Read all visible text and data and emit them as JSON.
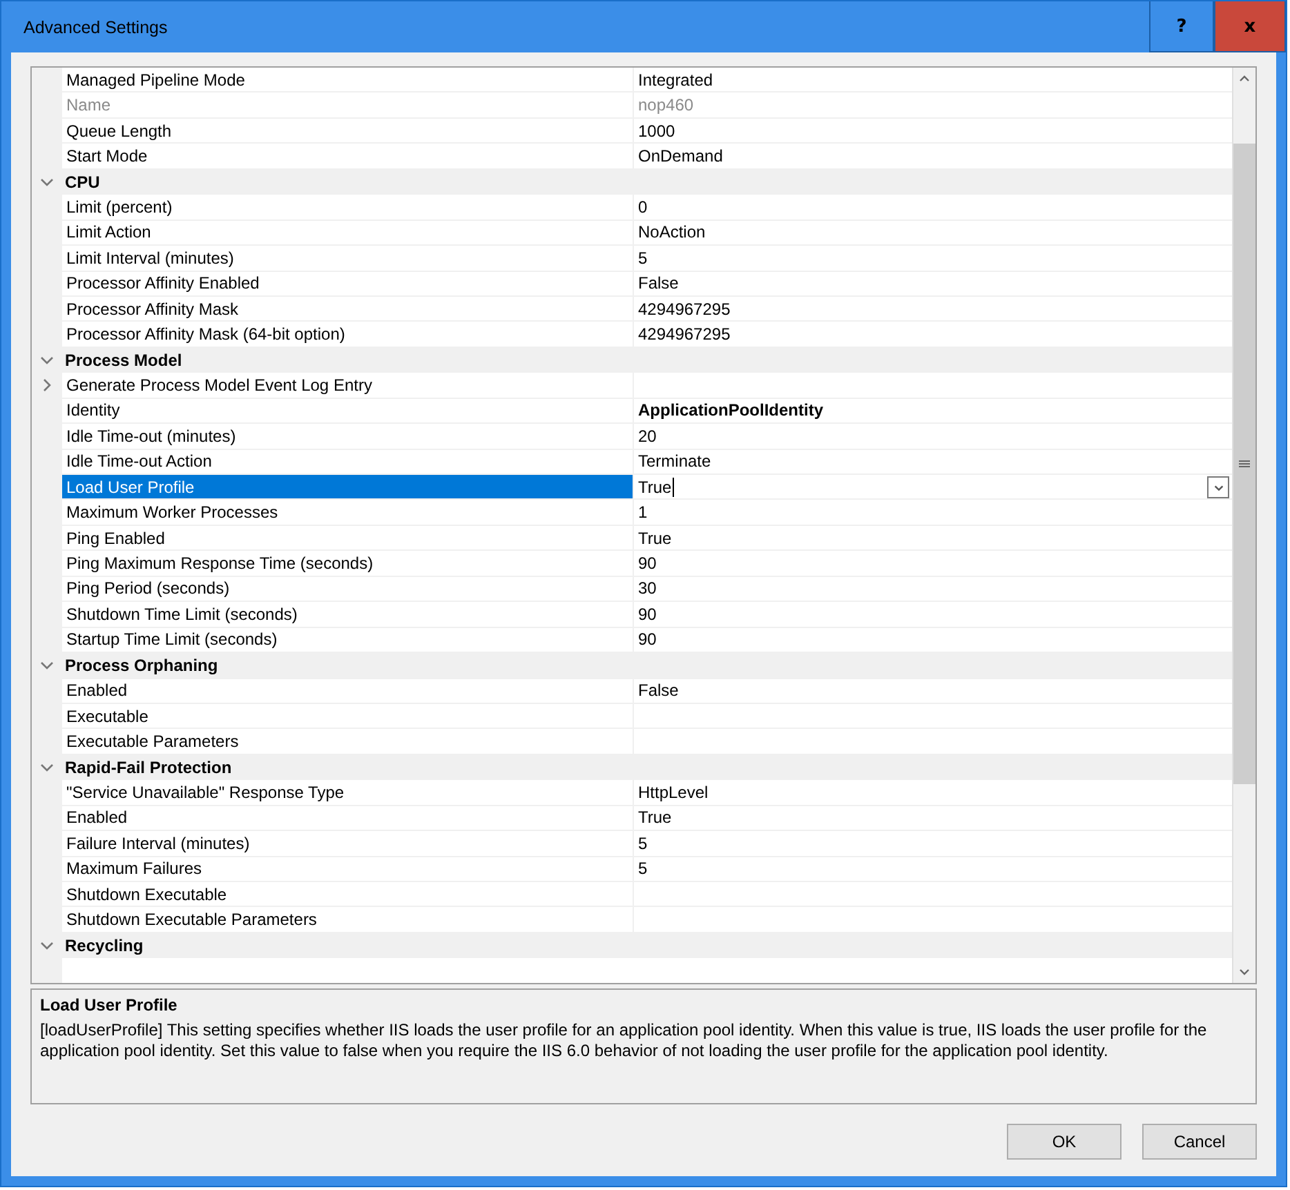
{
  "window": {
    "title": "Advanced Settings",
    "help_button": "?",
    "close_button": "x"
  },
  "grid": {
    "rows": [
      {
        "kind": "property",
        "name": "Managed Pipeline Mode",
        "value": "Integrated",
        "disabled": false,
        "modified": false,
        "selected": false
      },
      {
        "kind": "property",
        "name": "Name",
        "value": "nop460",
        "disabled": true,
        "modified": false,
        "selected": false
      },
      {
        "kind": "property",
        "name": "Queue Length",
        "value": "1000",
        "disabled": false,
        "modified": false,
        "selected": false
      },
      {
        "kind": "property",
        "name": "Start Mode",
        "value": "OnDemand",
        "disabled": false,
        "modified": false,
        "selected": false
      },
      {
        "kind": "section",
        "name": "CPU",
        "expanded": true
      },
      {
        "kind": "property",
        "name": "Limit (percent)",
        "value": "0",
        "disabled": false,
        "modified": false,
        "selected": false
      },
      {
        "kind": "property",
        "name": "Limit Action",
        "value": "NoAction",
        "disabled": false,
        "modified": false,
        "selected": false
      },
      {
        "kind": "property",
        "name": "Limit Interval (minutes)",
        "value": "5",
        "disabled": false,
        "modified": false,
        "selected": false
      },
      {
        "kind": "property",
        "name": "Processor Affinity Enabled",
        "value": "False",
        "disabled": false,
        "modified": false,
        "selected": false
      },
      {
        "kind": "property",
        "name": "Processor Affinity Mask",
        "value": "4294967295",
        "disabled": false,
        "modified": false,
        "selected": false
      },
      {
        "kind": "property",
        "name": "Processor Affinity Mask (64-bit option)",
        "value": "4294967295",
        "disabled": false,
        "modified": false,
        "selected": false
      },
      {
        "kind": "section",
        "name": "Process Model",
        "expanded": true
      },
      {
        "kind": "group",
        "name": "Generate Process Model Event Log Entry",
        "expanded": false
      },
      {
        "kind": "property",
        "name": "Identity",
        "value": "ApplicationPoolIdentity",
        "disabled": false,
        "modified": true,
        "selected": false
      },
      {
        "kind": "property",
        "name": "Idle Time-out (minutes)",
        "value": "20",
        "disabled": false,
        "modified": false,
        "selected": false
      },
      {
        "kind": "property",
        "name": "Idle Time-out Action",
        "value": "Terminate",
        "disabled": false,
        "modified": false,
        "selected": false
      },
      {
        "kind": "property",
        "name": "Load User Profile",
        "value": "True",
        "disabled": false,
        "modified": false,
        "selected": true
      },
      {
        "kind": "property",
        "name": "Maximum Worker Processes",
        "value": "1",
        "disabled": false,
        "modified": false,
        "selected": false
      },
      {
        "kind": "property",
        "name": "Ping Enabled",
        "value": "True",
        "disabled": false,
        "modified": false,
        "selected": false
      },
      {
        "kind": "property",
        "name": "Ping Maximum Response Time (seconds)",
        "value": "90",
        "disabled": false,
        "modified": false,
        "selected": false
      },
      {
        "kind": "property",
        "name": "Ping Period (seconds)",
        "value": "30",
        "disabled": false,
        "modified": false,
        "selected": false
      },
      {
        "kind": "property",
        "name": "Shutdown Time Limit (seconds)",
        "value": "90",
        "disabled": false,
        "modified": false,
        "selected": false
      },
      {
        "kind": "property",
        "name": "Startup Time Limit (seconds)",
        "value": "90",
        "disabled": false,
        "modified": false,
        "selected": false
      },
      {
        "kind": "section",
        "name": "Process Orphaning",
        "expanded": true
      },
      {
        "kind": "property",
        "name": "Enabled",
        "value": "False",
        "disabled": false,
        "modified": false,
        "selected": false
      },
      {
        "kind": "property",
        "name": "Executable",
        "disabled": false,
        "selected": false
      },
      {
        "kind": "property",
        "name": "Executable Parameters",
        "disabled": false,
        "selected": false
      },
      {
        "kind": "section",
        "name": "Rapid-Fail Protection",
        "expanded": true
      },
      {
        "kind": "property",
        "name": "\"Service Unavailable\" Response Type",
        "value": "HttpLevel",
        "disabled": false,
        "modified": false,
        "selected": false
      },
      {
        "kind": "property",
        "name": "Enabled",
        "value": "True",
        "disabled": false,
        "modified": false,
        "selected": false
      },
      {
        "kind": "property",
        "name": "Failure Interval (minutes)",
        "value": "5",
        "disabled": false,
        "modified": false,
        "selected": false
      },
      {
        "kind": "property",
        "name": "Maximum Failures",
        "value": "5",
        "disabled": false,
        "modified": false,
        "selected": false
      },
      {
        "kind": "property",
        "name": "Shutdown Executable",
        "disabled": false,
        "selected": false
      },
      {
        "kind": "property",
        "name": "Shutdown Executable Parameters",
        "disabled": false,
        "selected": false
      },
      {
        "kind": "section",
        "name": "Recycling",
        "expanded": true
      }
    ]
  },
  "description": {
    "title": "Load User Profile",
    "text": "[loadUserProfile] This setting specifies whether IIS loads the user profile for an application pool identity. When this value is true, IIS loads the user profile for the application pool identity. Set this value to false when you require the IIS 6.0 behavior of not loading the user profile for the application pool identity."
  },
  "buttons": [
    "OK",
    "Cancel"
  ]
}
